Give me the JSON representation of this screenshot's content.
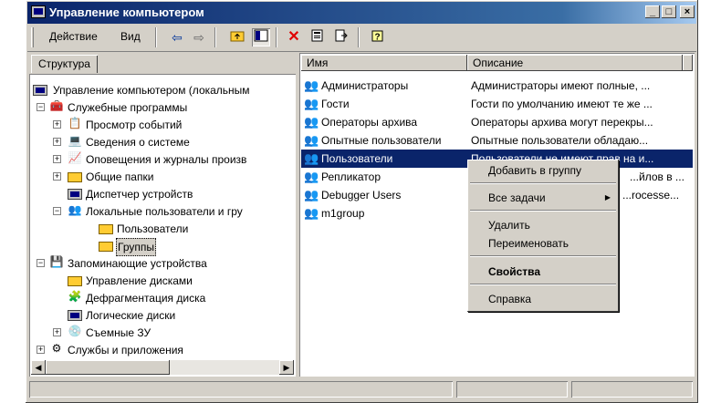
{
  "window": {
    "title": "Управление компьютером",
    "minimize": "_",
    "maximize": "□",
    "close": "×"
  },
  "toolbar": {
    "action_label": "Действие",
    "view_label": "Вид"
  },
  "left_tab": {
    "label": "Структура"
  },
  "tree": {
    "root": "Управление компьютером (локальным",
    "utilities": "Служебные программы",
    "event_viewer": "Просмотр событий",
    "system_info": "Сведения о системе",
    "alerts": "Оповещения и журналы произв",
    "shared_folders": "Общие папки",
    "device_manager": "Диспетчер устройств",
    "local_users": "Локальные пользователи и гру",
    "users": "Пользователи",
    "groups": "Группы",
    "storage": "Запоминающие устройства",
    "disk_mgmt": "Управление дисками",
    "defrag": "Дефрагментация диска",
    "logical_drives": "Логические диски",
    "removable": "Съемные ЗУ",
    "services": "Службы и приложения"
  },
  "list": {
    "col_name": "Имя",
    "col_desc": "Описание",
    "rows": [
      {
        "name": "Администраторы",
        "desc": "Администраторы имеют полные, ..."
      },
      {
        "name": "Гости",
        "desc": "Гости по умолчанию имеют те же ..."
      },
      {
        "name": "Операторы архива",
        "desc": "Операторы архива могут перекры..."
      },
      {
        "name": "Опытные пользователи",
        "desc": "Опытные пользователи обладаю..."
      },
      {
        "name": "Пользователи",
        "desc": "Пользователи не имеют прав на и..."
      },
      {
        "name": "Репликатор",
        "desc": "...йлов в ..."
      },
      {
        "name": "Debugger Users",
        "desc": "...rocesse..."
      },
      {
        "name": "m1group",
        "desc": ""
      }
    ]
  },
  "context_menu": {
    "add_to_group": "Добавить в группу",
    "all_tasks": "Все задачи",
    "delete": "Удалить",
    "rename": "Переименовать",
    "properties": "Свойства",
    "help": "Справка"
  }
}
